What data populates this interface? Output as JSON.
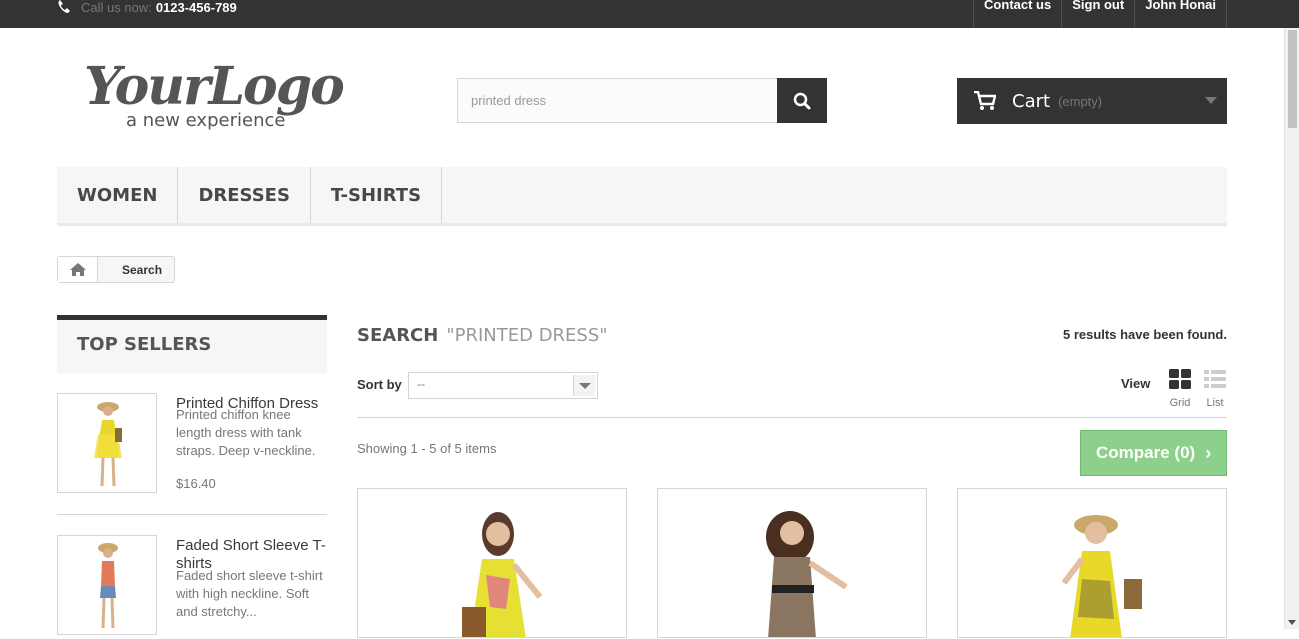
{
  "header": {
    "call_label": "Call us now:",
    "phone": "0123-456-789",
    "links": [
      "Contact us",
      "Sign out",
      "John Honai"
    ]
  },
  "logo": {
    "main_text": "YourLogo",
    "tagline": "a new experience"
  },
  "search": {
    "value": "printed dress",
    "icon": "search-icon"
  },
  "cart": {
    "label": "Cart",
    "status": "(empty)"
  },
  "menu": {
    "items": [
      "WOMEN",
      "DRESSES",
      "T-SHIRTS"
    ]
  },
  "breadcrumb": {
    "current": "Search"
  },
  "top_sellers": {
    "title": "TOP SELLERS",
    "items": [
      {
        "name": "Printed Chiffon Dress",
        "description": "Printed chiffon knee length dress with tank straps. Deep v-neckline.",
        "price": "$16.40"
      },
      {
        "name": "Faded Short Sleeve T-shirts",
        "description": "Faded short sleeve t-shirt with high neckline. Soft and stretchy..."
      }
    ]
  },
  "results": {
    "title": "SEARCH",
    "query": "\"PRINTED DRESS\"",
    "count_text": "5 results have been found.",
    "sort_label": "Sort by",
    "sort_value": "--",
    "view_label": "View",
    "view_grid": "Grid",
    "view_list": "List",
    "showing": "Showing 1 - 5 of 5 items",
    "compare": "Compare (0)"
  },
  "colors": {
    "topbar": "#333333",
    "compare_green": "#78c878",
    "accent_dark": "#333333"
  }
}
